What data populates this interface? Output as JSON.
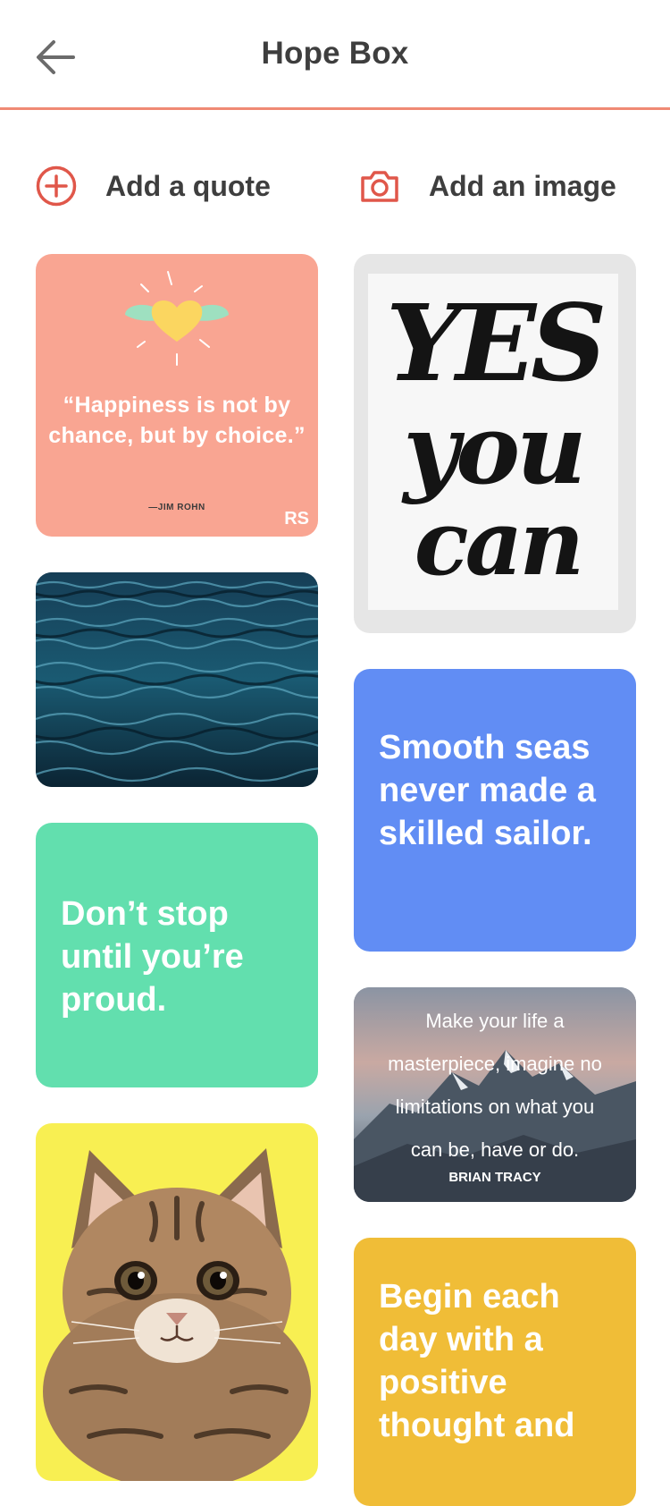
{
  "header": {
    "title": "Hope Box",
    "back_icon": "arrow-left-icon"
  },
  "actions": {
    "add_quote": {
      "label": "Add a quote",
      "icon": "plus-circle-icon"
    },
    "add_image": {
      "label": "Add an image",
      "icon": "camera-icon"
    }
  },
  "colors": {
    "accent": "#f08a74",
    "card_peach": "#f9a592",
    "card_green": "#62dfae",
    "card_blue": "#618df4",
    "card_yellow": "#f0bd37",
    "kitten_bg": "#f8ef52"
  },
  "cards": {
    "happiness": {
      "quote": "“Happiness is not by chance, but by choice.”",
      "author": "—JIM ROHN",
      "badge": "RS"
    },
    "yes_you_can": {
      "line1": "YES",
      "line2": "you",
      "line3": "can"
    },
    "dont_stop": {
      "text": "Don’t stop until you’re proud."
    },
    "smooth_seas": {
      "text": "Smooth seas never made a skilled sailor."
    },
    "masterpiece": {
      "quote": "Make your life a masterpiece, imagine no limitations on what you can be, have or do.",
      "author": "BRIAN TRACY"
    },
    "begin_each_day": {
      "text": "Begin each day with a positive thought and"
    }
  }
}
